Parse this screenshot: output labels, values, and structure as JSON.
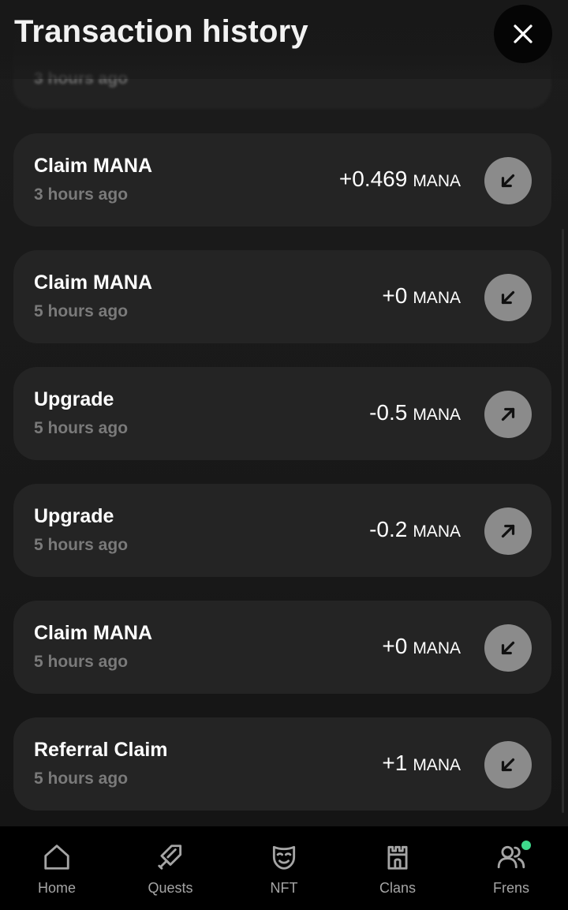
{
  "header": {
    "title": "Transaction history"
  },
  "partial_item": {
    "time": "3 hours ago"
  },
  "transactions": [
    {
      "title": "Claim MANA",
      "time": "3 hours ago",
      "amount": "+0.469",
      "currency": "MANA",
      "direction": "incoming",
      "icon": "arrow-down-left-icon"
    },
    {
      "title": "Claim MANA",
      "time": "5 hours ago",
      "amount": "+0",
      "currency": "MANA",
      "direction": "incoming",
      "icon": "arrow-down-left-icon"
    },
    {
      "title": "Upgrade",
      "time": "5 hours ago",
      "amount": "-0.5",
      "currency": "MANA",
      "direction": "outgoing",
      "icon": "arrow-up-right-icon"
    },
    {
      "title": "Upgrade",
      "time": "5 hours ago",
      "amount": "-0.2",
      "currency": "MANA",
      "direction": "outgoing",
      "icon": "arrow-up-right-icon"
    },
    {
      "title": "Claim MANA",
      "time": "5 hours ago",
      "amount": "+0",
      "currency": "MANA",
      "direction": "incoming",
      "icon": "arrow-down-left-icon"
    },
    {
      "title": "Referral Claim",
      "time": "5 hours ago",
      "amount": "+1",
      "currency": "MANA",
      "direction": "incoming",
      "icon": "arrow-down-left-icon"
    }
  ],
  "nav": {
    "items": [
      {
        "label": "Home",
        "icon": "home-icon"
      },
      {
        "label": "Quests",
        "icon": "sword-icon"
      },
      {
        "label": "NFT",
        "icon": "mask-icon"
      },
      {
        "label": "Clans",
        "icon": "castle-icon"
      },
      {
        "label": "Frens",
        "icon": "friends-icon",
        "notification": true
      }
    ]
  },
  "colors": {
    "background": "#181818",
    "card": "#242424",
    "secondary_text": "#7a7a7a",
    "arrow_badge": "#8b8b8b",
    "nav_background": "#000000",
    "notification_dot": "#3fd98c"
  }
}
